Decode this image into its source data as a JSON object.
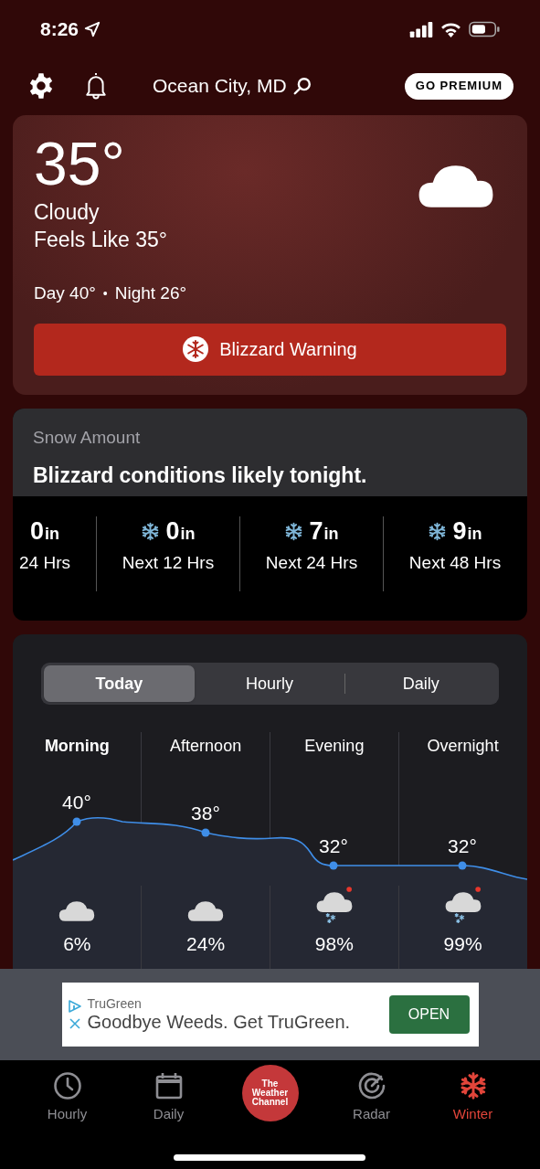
{
  "status_bar": {
    "time": "8:26"
  },
  "header": {
    "location": "Ocean City, MD",
    "premium_button": "GO PREMIUM"
  },
  "current": {
    "temperature": "35°",
    "condition": "Cloudy",
    "feels_like": "Feels Like 35°",
    "day": "Day 40°",
    "separator": "•",
    "night": "Night 26°",
    "alert": "Blizzard Warning"
  },
  "snow": {
    "title": "Snow Amount",
    "headline": "Blizzard conditions likely tonight.",
    "items": [
      {
        "amount": "0",
        "unit": "in",
        "label": "24 Hrs",
        "snow_icon": false
      },
      {
        "amount": "0",
        "unit": "in",
        "label": "Next 12 Hrs",
        "snow_icon": true
      },
      {
        "amount": "7",
        "unit": "in",
        "label": "Next 24 Hrs",
        "snow_icon": true
      },
      {
        "amount": "9",
        "unit": "in",
        "label": "Next 48 Hrs",
        "snow_icon": true
      }
    ]
  },
  "forecast": {
    "tabs": [
      {
        "label": "Today",
        "selected": true
      },
      {
        "label": "Hourly",
        "selected": false
      },
      {
        "label": "Daily",
        "selected": false
      }
    ],
    "periods": [
      {
        "name": "Morning",
        "current": true,
        "temp": "40°",
        "kind": "cloudy",
        "precip": "6%"
      },
      {
        "name": "Afternoon",
        "current": false,
        "temp": "38°",
        "kind": "cloudy",
        "precip": "24%"
      },
      {
        "name": "Evening",
        "current": false,
        "temp": "32°",
        "kind": "snow",
        "precip": "98%"
      },
      {
        "name": "Overnight",
        "current": false,
        "temp": "32°",
        "kind": "snow",
        "precip": "99%"
      }
    ]
  },
  "ad": {
    "advertiser": "TruGreen",
    "headline": "Goodbye Weeds. Get TruGreen.",
    "button": "OPEN"
  },
  "tab_bar": {
    "items": [
      {
        "kind": "clock",
        "label": "Hourly",
        "selected": false
      },
      {
        "kind": "calendar",
        "label": "Daily",
        "selected": false
      },
      {
        "kind": "logo",
        "label": "The Weather Channel"
      },
      {
        "kind": "radar",
        "label": "Radar",
        "selected": false
      },
      {
        "kind": "snowflake",
        "label": "Winter",
        "selected": true
      }
    ]
  }
}
